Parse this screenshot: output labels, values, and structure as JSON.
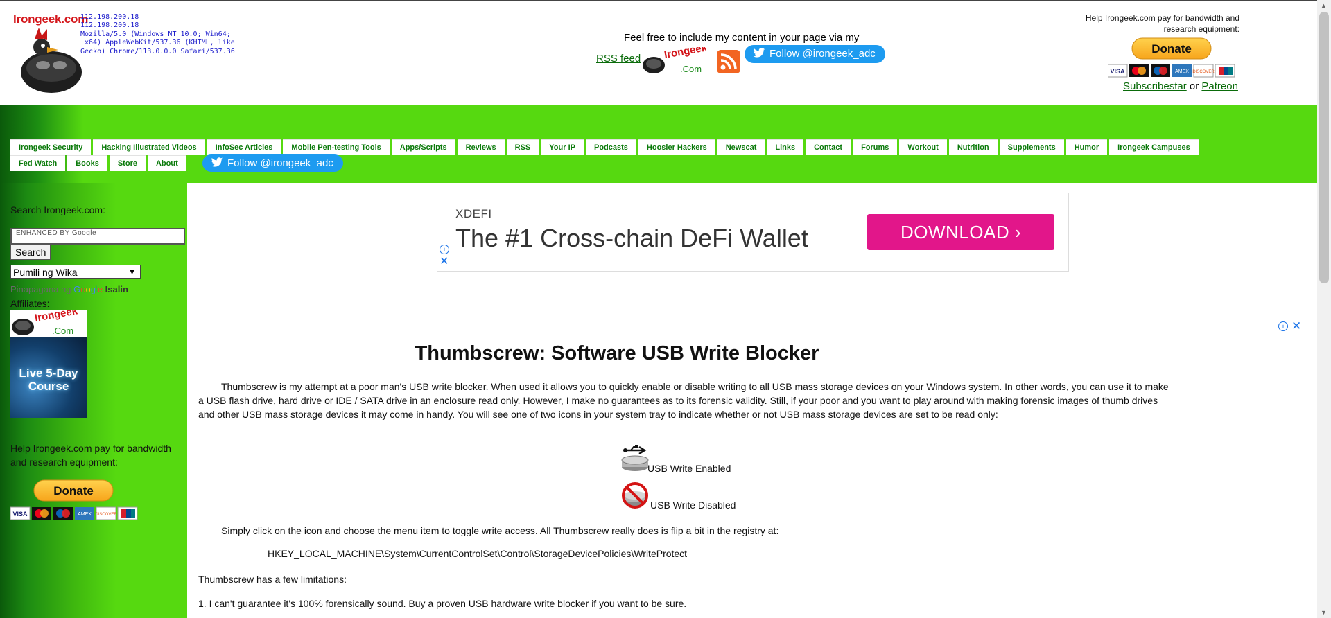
{
  "header": {
    "logo_text": "Irongeek.com",
    "user_agent_lines": [
      "112.198.200.18",
      "112.198.200.18",
      "Mozilla/5.0 (Windows NT 10.0; Win64;",
      " x64) AppleWebKit/537.36 (KHTML, like",
      "Gecko) Chrome/113.0.0.0 Safari/537.36"
    ],
    "feed_text": "Feel free to include my content in your page via my",
    "rss_link": "RSS feed",
    "mini_logo_text": "Irongeek",
    "mini_logo_sub": ".Com",
    "follow_adc": "Follow @irongeek_adc",
    "help_text": "Help Irongeek.com pay for bandwidth and research equipment:",
    "donate_label": "Donate",
    "subscribestar": "Subscribestar",
    "or_text": " or ",
    "patreon": "Patreon"
  },
  "nav": {
    "row1": [
      "Irongeek Security",
      "Hacking Illustrated Videos",
      "InfoSec Articles",
      "Mobile Pen-testing Tools",
      "Apps/Scripts",
      "Reviews",
      "RSS",
      "Your IP",
      "Podcasts",
      "Hoosier Hackers",
      "Newscat",
      "Links",
      "Contact",
      "Forums",
      "Workout",
      "Nutrition",
      "Supplements",
      "Humor",
      "Irongeek Campuses"
    ],
    "row2": [
      "Fed Watch",
      "Books",
      "Store",
      "About"
    ],
    "follow": "Follow @irongeek_adc"
  },
  "sidebar": {
    "search_label": "Search Irongeek.com:",
    "search_placeholder": "ENHANCED BY Google",
    "search_button": "Search",
    "language_select": "Pumili ng Wika",
    "powered_prefix": "Pinapagana ng ",
    "google_letters": [
      "G",
      "o",
      "o",
      "g",
      "l",
      "e"
    ],
    "translate_link": "Isalin",
    "affiliates_label": "Affiliates:",
    "aff_logo_text": "Irongeek",
    "aff_logo_sub": ".Com",
    "course_text": "Live 5-Day Course",
    "help_text": "Help Irongeek.com pay for bandwidth and research equipment:",
    "donate_label": "Donate"
  },
  "ad": {
    "brand": "XDEFI",
    "headline": "The #1 Cross-chain DeFi Wallet",
    "button": "DOWNLOAD ›",
    "info_glyph": "i",
    "close_glyph": "✕"
  },
  "article": {
    "title": "Thumbscrew: Software USB Write Blocker",
    "p1": "Thumbscrew is my attempt at a poor man's USB write blocker. When used it allows you to quickly enable or disable writing to all USB mass storage devices on your Windows system. In other words, you can use it to make a USB flash drive, hard drive or IDE / SATA drive in an enclosure read only. However, I make no guarantees as to its forensic validity. Still, if your poor and you want to play around with making forensic images of thumb drives and other USB mass storage devices it may come in handy. You will see one of two icons in your system tray to indicate whether or not USB mass storage devices are set to be read only:",
    "icon_enabled": "USB Write Enabled",
    "icon_disabled": "USB Write Disabled",
    "p2": "Simply click on the icon and choose the menu item to toggle write access. All Thumbscrew really does is flip a bit in the registry at:",
    "reg_path": "HKEY_LOCAL_MACHINE\\System\\CurrentControlSet\\Control\\StorageDevicePolicies\\WriteProtect",
    "p3": "Thumbscrew has a few limitations:",
    "p4": "1. I can't guarantee it's 100% forensically sound. Buy a proven USB hardware write blocker if you want to be sure."
  },
  "colors": {
    "nav_green": "#56d910",
    "link_green": "#0a6b0a",
    "twitter_blue": "#1d9bf0",
    "ad_pink": "#e2168a",
    "logo_red": "#d4161b"
  }
}
